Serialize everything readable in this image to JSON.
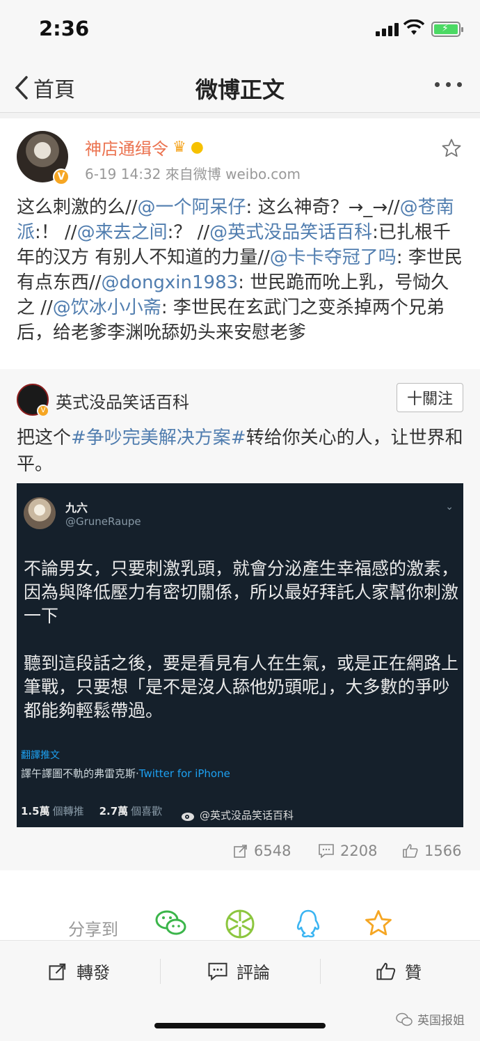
{
  "status_bar": {
    "time": "2:36"
  },
  "nav": {
    "back_label": "首頁",
    "title": "微博正文"
  },
  "post": {
    "author": "神店通缉令",
    "meta": "6-19 14:32  來自微博 weibo.com",
    "text": [
      {
        "t": "这么刺激的么//",
        "m": false
      },
      {
        "t": "@一个阿呆仔",
        "m": true
      },
      {
        "t": ": 这么神奇？→_→//",
        "m": false
      },
      {
        "t": "@苍南派",
        "m": true
      },
      {
        "t": ":！ //",
        "m": false
      },
      {
        "t": "@来去之间",
        "m": true
      },
      {
        "t": ":？ //",
        "m": false
      },
      {
        "t": "@英式没品笑话百科",
        "m": true
      },
      {
        "t": ":已扎根千年的汉方 有别人不知道的力量//",
        "m": false
      },
      {
        "t": "@卡卡夺冠了吗",
        "m": true
      },
      {
        "t": ": 李世民有点东西//",
        "m": false
      },
      {
        "t": "@dongxin1983",
        "m": true
      },
      {
        "t": ": 世民跪而吮上乳，号恸久之 //",
        "m": false
      },
      {
        "t": "@饮冰小小斋",
        "m": true
      },
      {
        "t": ": 李世民在玄武门之变杀掉两个兄弟后，给老爹李渊吮舔奶头来安慰老爹",
        "m": false
      }
    ]
  },
  "repost": {
    "author": "英式没品笑话百科",
    "follow_label": "十關注",
    "text_before": "把这个",
    "hashtag": "#争吵完美解决方案#",
    "text_after": "转给你关心的人，让世界和平。",
    "tweet": {
      "name": "九六",
      "handle": "@GruneRaupe",
      "para1": "不論男女，只要刺激乳頭，就會分泌產生幸福感的激素，因為與降低壓力有密切關係，所以最好拜託人家幫你刺激一下",
      "para2": "聽到這段話之後，要是看見有人在生氣，或是正在網路上筆戰，只要想「是不是沒人舔他奶頭呢」，大多數的爭吵都能夠輕鬆帶過。",
      "translate": "翻譯推文",
      "source_prefix": "譯午譯圖不軌的弗雷克斯·",
      "source_client": "Twitter for iPhone",
      "retweets_num": "1.5萬",
      "retweets_label": "個轉推",
      "likes_num": "2.7萬",
      "likes_label": "個喜歡",
      "watermark": "@英式没品笑话百科"
    },
    "actions": {
      "reposts": "6548",
      "comments": "2208",
      "likes": "1566"
    }
  },
  "share": {
    "label": "分享到"
  },
  "toolbar": {
    "repost": "轉發",
    "comment": "評論",
    "like": "贊"
  },
  "watermark": "英国报姐",
  "colors": {
    "author": "#eb7350",
    "link": "#507daf",
    "tweet_bg": "#15202b"
  }
}
